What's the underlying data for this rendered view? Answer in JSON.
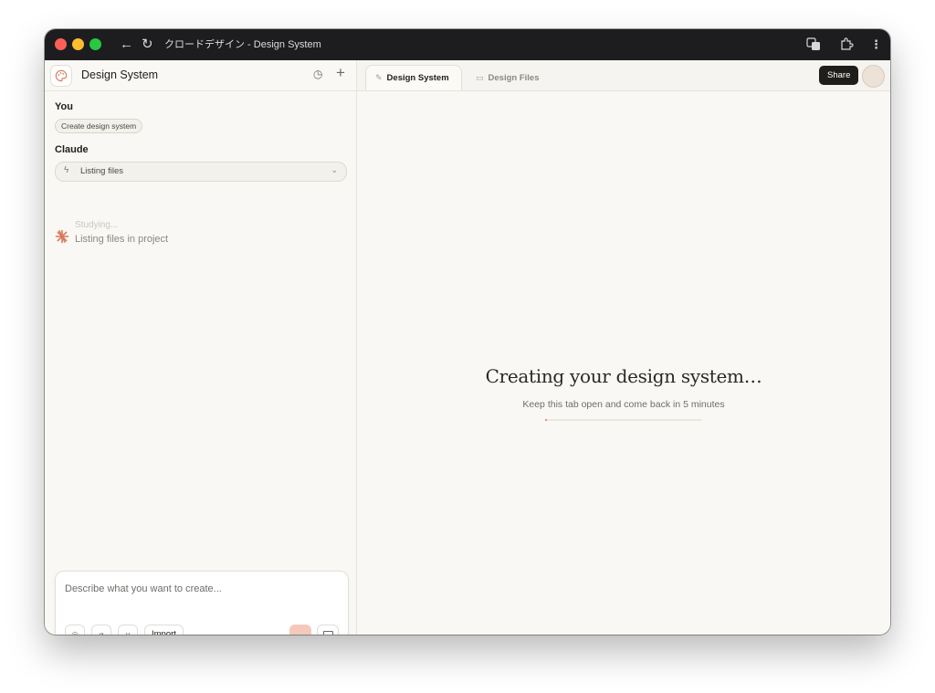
{
  "window": {
    "title": "クロードデザイン - Design System"
  },
  "sidebar": {
    "project_title": "Design System",
    "you_label": "You",
    "user_message": "Create design system",
    "claude_label": "Claude",
    "tool_call": "Listing files",
    "thinking_previous": "Studying...",
    "thinking_current": "Listing files in project"
  },
  "composer": {
    "placeholder": "Describe what you want to create...",
    "import_label": "Import"
  },
  "tabs": [
    {
      "label": "Design System",
      "active": true
    },
    {
      "label": "Design Files",
      "active": false
    }
  ],
  "header": {
    "share_label": "Share"
  },
  "main": {
    "headline": "Creating your design system…",
    "subline": "Keep this tab open and come back in 5 minutes",
    "progress": 0.01
  },
  "colors": {
    "accent": "#d97757",
    "titlebar": "#1d1d1f",
    "background": "#f9f8f5"
  }
}
